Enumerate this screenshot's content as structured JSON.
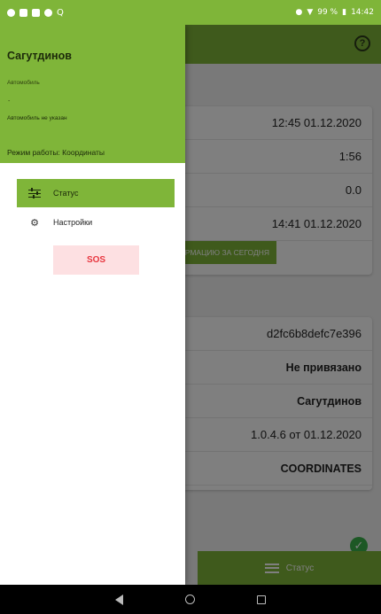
{
  "status_bar": {
    "icons_left": [
      "android-icon",
      "notification-icon",
      "image-icon",
      "sync-icon",
      "search-icon"
    ],
    "battery": "99 %",
    "time": "14:42"
  },
  "app_bar": {
    "help_icon": "help-circle-icon"
  },
  "status_card_1": {
    "rows": [
      "12:45 01.12.2020",
      "1:56",
      "0.0",
      "14:41 01.12.2020"
    ],
    "info_button": "ОРМАЦИЮ ЗА СЕГОДНЯ"
  },
  "status_card_2": {
    "rows": [
      "d2fc6b8defc7e396",
      "Не привязано",
      "Сагутдинов",
      "1.0.4.6 от 01.12.2020",
      "COORDINATES"
    ]
  },
  "bottom_nav": {
    "label": "Статус",
    "icon": "list-icon"
  },
  "drawer": {
    "header": {
      "name": "Сагутдинов",
      "vehicle_label": "Автомобиль",
      "dot": "-",
      "vehicle_value": "Автомобиль не указан",
      "mode": "Режим работы: Координаты"
    },
    "menu": [
      {
        "label": "Статус",
        "icon": "tune-icon",
        "active": true
      },
      {
        "label": "Настройки",
        "icon": "gear-icon",
        "active": false
      }
    ],
    "sos_label": "SOS"
  },
  "colors": {
    "accent": "#7fb539",
    "sos_bg": "#fde0e2",
    "sos_text": "#e8363f"
  }
}
